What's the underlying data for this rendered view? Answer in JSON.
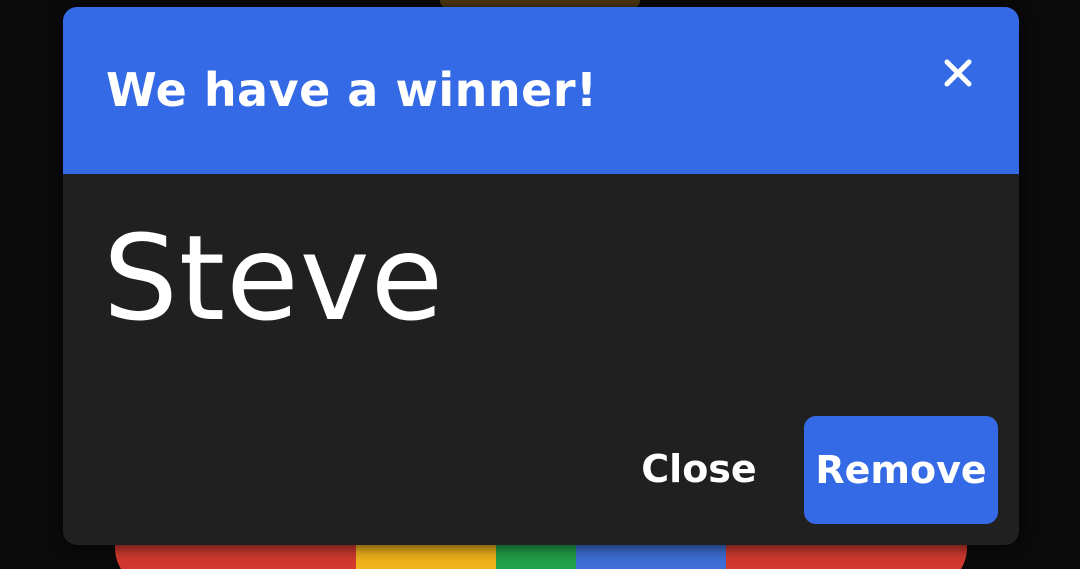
{
  "dialog": {
    "title": "We have a winner!",
    "close_icon": "close-icon",
    "winner_name": "Steve",
    "buttons": {
      "close_label": "Close",
      "remove_label": "Remove"
    }
  },
  "colors": {
    "header": "#356ae6",
    "dialog_body": "#202020",
    "primary_button": "#356ae6",
    "text": "#ffffff"
  }
}
